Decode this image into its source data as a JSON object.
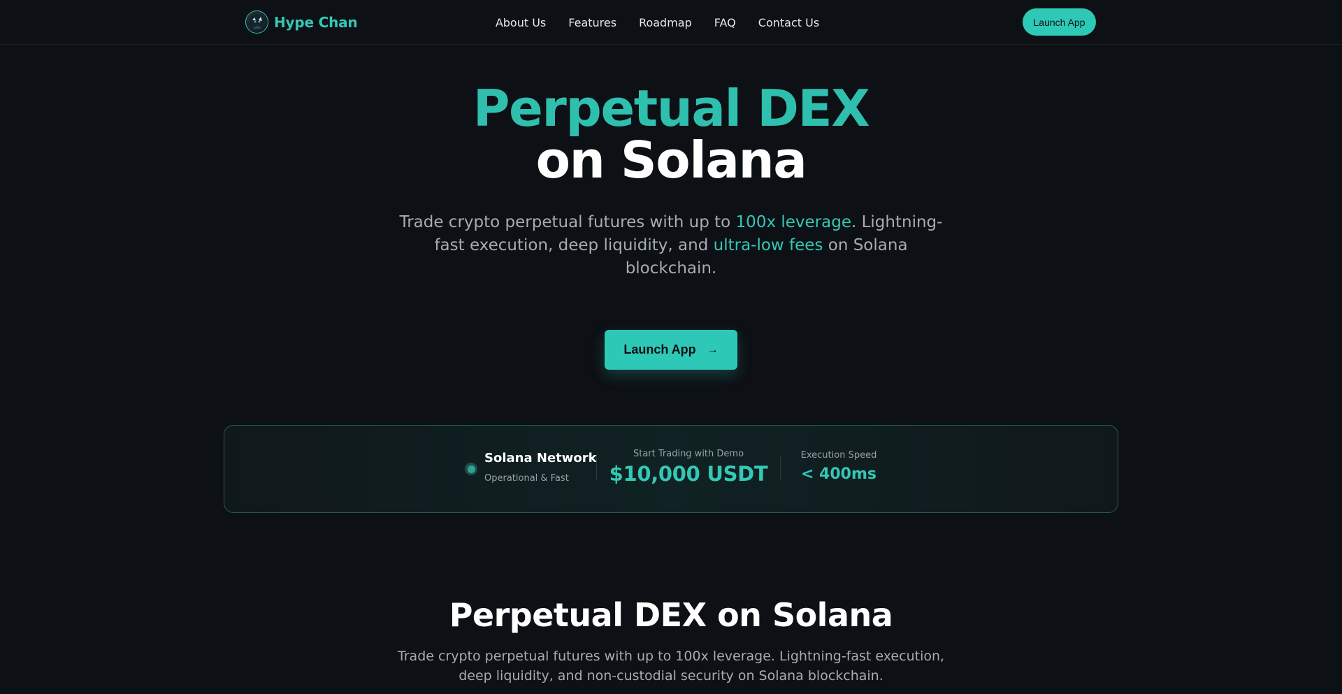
{
  "brand": {
    "name": "Hype Chan",
    "logo_icon": "mascot-avatar-icon",
    "accent_color": "#2ec9b6"
  },
  "nav": {
    "items": [
      {
        "label": "About Us"
      },
      {
        "label": "Features"
      },
      {
        "label": "Roadmap"
      },
      {
        "label": "FAQ"
      },
      {
        "label": "Contact Us"
      }
    ],
    "cta_label": "Launch App"
  },
  "hero": {
    "title_line1": "Perpetual DEX",
    "title_line2": "on Solana",
    "sub_part1": "Trade crypto perpetual futures with up to ",
    "sub_hl1": "100x leverage",
    "sub_part2": ". Lightning-fast execution, deep liquidity, and ",
    "sub_hl2": "ultra-low fees",
    "sub_part3": " on Solana blockchain.",
    "cta_label": "Launch App",
    "cta_icon": "arrow-right-icon"
  },
  "stats": {
    "network_title": "Solana Network",
    "network_status": "Operational & Fast",
    "demo_label": "Start Trading with Demo",
    "demo_value": "$10,000 USDT",
    "speed_label": "Execution Speed",
    "speed_value": "< 400ms"
  },
  "section": {
    "title": "Perpetual DEX on Solana",
    "subtitle": "Trade crypto perpetual futures with up to 100x leverage. Lightning-fast execution, deep liquidity, and non-custodial security on Solana blockchain."
  }
}
